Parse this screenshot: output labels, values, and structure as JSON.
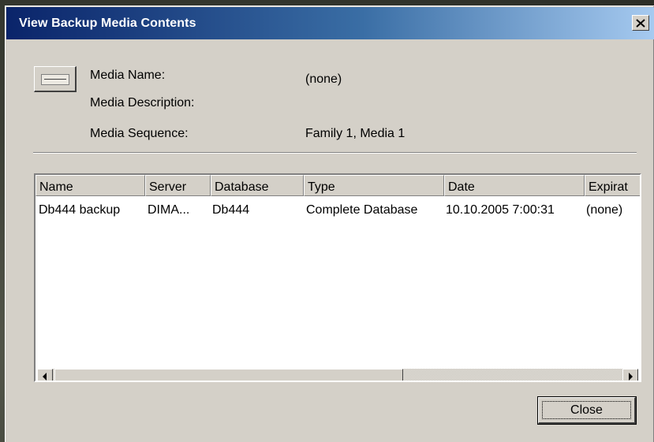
{
  "window": {
    "title": "View Backup Media Contents",
    "close_glyph": "✕"
  },
  "media": {
    "icon": "tape-media-icon",
    "name_label": "Media Name:",
    "name_value": "(none)",
    "description_label": "Media Description:",
    "description_value": "",
    "sequence_label": "Media Sequence:",
    "sequence_value": "Family 1, Media 1"
  },
  "table": {
    "columns": [
      "Name",
      "Server",
      "Database",
      "Type",
      "Date",
      "Expirat"
    ],
    "rows": [
      {
        "name": "Db444 backup",
        "server": "DIMA...",
        "database": "Db444",
        "type": "Complete Database",
        "date": "10.10.2005 7:00:31",
        "expiration": "(none)"
      }
    ]
  },
  "buttons": {
    "close_label": "Close"
  },
  "colors": {
    "titlebar_start": "#0a246a",
    "titlebar_end": "#a6caf0",
    "dialog_face": "#d4d0c8"
  }
}
